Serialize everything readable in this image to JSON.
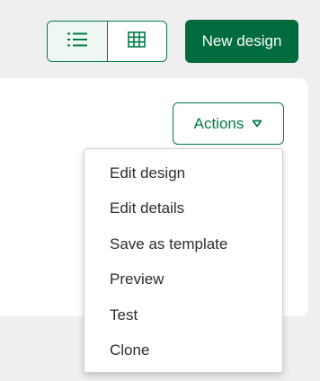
{
  "toolbar": {
    "view_toggle": {
      "options": [
        {
          "icon": "list-icon",
          "active": true
        },
        {
          "icon": "grid-icon",
          "active": false
        }
      ]
    },
    "new_design_label": "New design"
  },
  "card": {
    "actions_label": "Actions",
    "actions_icon": "caret-down-icon",
    "menu": [
      {
        "label": "Edit design"
      },
      {
        "label": "Edit details"
      },
      {
        "label": "Save as template"
      },
      {
        "label": "Preview"
      },
      {
        "label": "Test"
      },
      {
        "label": "Clone"
      }
    ]
  },
  "colors": {
    "brand_green": "#006b3c",
    "outline_green": "#007b45",
    "page_background": "#efefef",
    "menu_text": "#2d2d2d"
  }
}
